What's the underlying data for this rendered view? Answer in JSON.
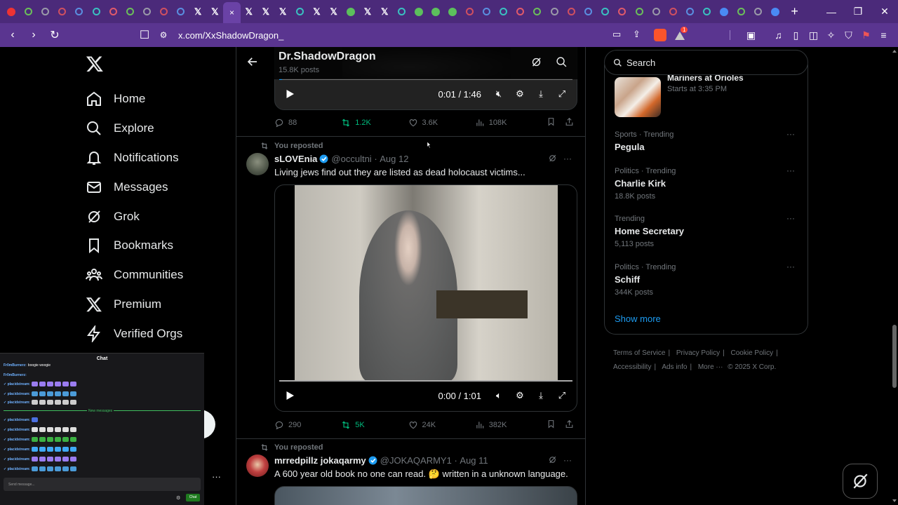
{
  "browser": {
    "url": "x.com/XxShadowDragon_",
    "tabs": [
      "youtube-icon",
      "tab-icon",
      "tab-icon",
      "tab-icon",
      "tab-icon",
      "tab-icon",
      "tab-icon",
      "tab-icon",
      "tab-icon",
      "tab-icon",
      "tab-icon",
      "x-icon",
      "x-icon",
      "active",
      "x-icon",
      "x-icon",
      "x-icon",
      "tab-icon",
      "x-icon",
      "x-icon",
      "play-icon",
      "x-icon",
      "x-icon",
      "tab-icon",
      "play-icon",
      "play-icon",
      "play-icon",
      "tab-icon",
      "tab-icon",
      "tab-icon",
      "tab-icon",
      "tab-icon",
      "tab-icon",
      "tab-icon",
      "tab-icon",
      "tab-icon",
      "tab-icon",
      "tab-icon",
      "tab-icon",
      "tab-icon",
      "tab-icon",
      "tab-icon",
      "google-icon",
      "tab-icon",
      "tab-icon",
      "google-icon"
    ],
    "active_tab_close": "×",
    "new_tab": "+",
    "notification_badge": "1",
    "accent": "#4b2a7a"
  },
  "sidebar": {
    "items": [
      {
        "label": "Home",
        "icon": "home-icon"
      },
      {
        "label": "Explore",
        "icon": "search-icon"
      },
      {
        "label": "Notifications",
        "icon": "bell-icon"
      },
      {
        "label": "Messages",
        "icon": "mail-icon"
      },
      {
        "label": "Grok",
        "icon": "grok-icon"
      },
      {
        "label": "Bookmarks",
        "icon": "bookmark-icon"
      },
      {
        "label": "Communities",
        "icon": "communities-icon"
      },
      {
        "label": "Premium",
        "icon": "x-icon"
      },
      {
        "label": "Verified Orgs",
        "icon": "lightning-icon"
      }
    ]
  },
  "header": {
    "name": "Dr.ShadowDragon",
    "posts": "15.8K posts"
  },
  "tweets": [
    {
      "video_time": "0:01 / 1:46",
      "progress": 0.01,
      "replies": "88",
      "reposts": "1.2K",
      "likes": "3.6K",
      "views": "108K"
    },
    {
      "repost_label": "You reposted",
      "name": "sLOVEnia",
      "handle": "@occultni",
      "date": "Aug 12",
      "text": "Living jews find out they are listed as dead holocaust victims...",
      "video_time": "0:00 / 1:01",
      "progress": 0.0,
      "replies": "290",
      "reposts": "5K",
      "likes": "24K",
      "views": "382K"
    },
    {
      "repost_label": "You reposted",
      "name": "mrredpillz jokaqarmy",
      "handle": "@JOKAQARMY1",
      "date": "Aug 11",
      "text": "A 600 year old book no one can read. 🤔 written in a unknown language."
    }
  ],
  "search": {
    "placeholder": "Search"
  },
  "trends": {
    "event_title": "Mariners at Orioles",
    "event_sub": "Starts at 3:35 PM",
    "items": [
      {
        "category": "Sports · Trending",
        "title": "Pegula",
        "count": ""
      },
      {
        "category": "Politics · Trending",
        "title": "Charlie Kirk",
        "count": "18.8K posts"
      },
      {
        "category": "Trending",
        "title": "Home Secretary",
        "count": "5,113 posts"
      },
      {
        "category": "Politics · Trending",
        "title": "Schiff",
        "count": "344K posts"
      }
    ],
    "show_more": "Show more"
  },
  "footer": {
    "links": [
      "Terms of Service",
      "Privacy Policy",
      "Cookie Policy",
      "Accessibility",
      "Ads info",
      "More ···",
      "© 2025 X Corp."
    ]
  },
  "chat": {
    "title": "Chat",
    "lines": [
      {
        "user": "Fr0mBurnerz:",
        "text": "boogie woogie"
      },
      {
        "user": "Fr0mBurnerz:",
        "text": ""
      },
      {
        "user": "placidstream:",
        "text": ""
      },
      {
        "user": "placidstream:",
        "text": ""
      },
      {
        "user": "placidstream:",
        "text": ""
      },
      {
        "user": "placidstream:",
        "text": ""
      },
      {
        "user": "placidstream:",
        "text": ""
      },
      {
        "user": "placidstream:",
        "text": ""
      },
      {
        "user": "placidstream:",
        "text": ""
      },
      {
        "user": "placidstream:",
        "text": ""
      },
      {
        "user": "placidstream:",
        "text": ""
      }
    ],
    "new_messages": "New messages",
    "input_placeholder": "Send message...",
    "send_label": "Chat"
  },
  "menu_dots": "···"
}
